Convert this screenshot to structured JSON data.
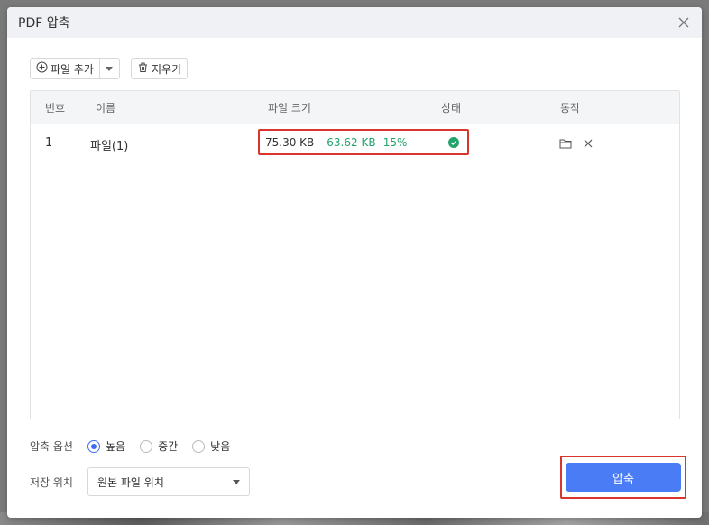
{
  "dialog": {
    "title": "PDF 압축"
  },
  "toolbar": {
    "add_file_label": "파일 추가",
    "clear_label": "지우기"
  },
  "table": {
    "headers": {
      "number": "번호",
      "name": "이름",
      "size": "파일 크기",
      "status": "상태",
      "action": "동작"
    },
    "rows": [
      {
        "number": "1",
        "name": "파일(1)",
        "old_size": "75.30 KB",
        "new_size": "63.62 KB -15%",
        "status_icon": "check-circle-icon"
      }
    ]
  },
  "options": {
    "label": "압축 옵션",
    "choices": [
      {
        "label": "높음",
        "selected": true
      },
      {
        "label": "중간",
        "selected": false
      },
      {
        "label": "낮음",
        "selected": false
      }
    ]
  },
  "save": {
    "label": "저장 위치",
    "selected": "원본 파일 위치"
  },
  "compress_button": "압축",
  "colors": {
    "accent": "#4a7df5",
    "success": "#22a36a",
    "highlight": "#d9352b"
  }
}
